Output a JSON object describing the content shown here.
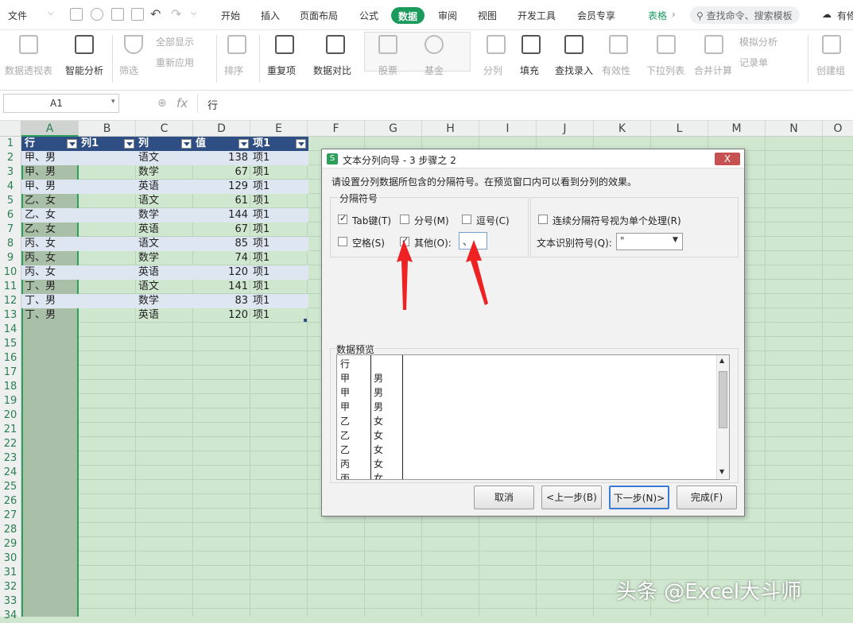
{
  "menu": {
    "file": "文件",
    "tabs": [
      "开始",
      "插入",
      "页面布局",
      "公式",
      "数据",
      "审阅",
      "视图",
      "开发工具",
      "会员专享",
      "表格"
    ],
    "active_tab": "数据",
    "search": "查找命令、搜索模板",
    "extra": "有修"
  },
  "ribbon": {
    "pivot": "数据透视表",
    "smart": "智能分析",
    "filter": "筛选",
    "show_all": "全部显示",
    "reapply": "重新应用",
    "sort": "排序",
    "duplicates": "重复项",
    "compare": "数据对比",
    "stocks": "股票",
    "fund": "基金",
    "split": "分列",
    "fill": "填充",
    "lookup": "查找录入",
    "validity": "有效性",
    "dropdown": "下拉列表",
    "consolidate": "合并计算",
    "simulate": "模拟分析",
    "record": "记录单",
    "group": "创建组"
  },
  "formula": {
    "name_box": "A1",
    "fx": "fx",
    "value": "行"
  },
  "columns": [
    "A",
    "B",
    "C",
    "D",
    "E",
    "F",
    "G",
    "H",
    "I",
    "J",
    "K",
    "L",
    "M",
    "N",
    "O"
  ],
  "rows": [
    "1",
    "2",
    "3",
    "4",
    "5",
    "6",
    "7",
    "8",
    "9",
    "10",
    "11",
    "12",
    "13",
    "14",
    "15",
    "16",
    "17",
    "18",
    "19",
    "20",
    "21",
    "22",
    "23",
    "24",
    "25",
    "26",
    "27",
    "28",
    "29",
    "30",
    "31",
    "32",
    "33",
    "34"
  ],
  "table": {
    "headers": [
      "行",
      "列1",
      "列",
      "值",
      "项1"
    ],
    "rows": [
      [
        "甲、男",
        "",
        "语文",
        "138",
        "项1"
      ],
      [
        "甲、男",
        "",
        "数学",
        "67",
        "项1"
      ],
      [
        "甲、男",
        "",
        "英语",
        "129",
        "项1"
      ],
      [
        "乙、女",
        "",
        "语文",
        "61",
        "项1"
      ],
      [
        "乙、女",
        "",
        "数学",
        "144",
        "项1"
      ],
      [
        "乙、女",
        "",
        "英语",
        "67",
        "项1"
      ],
      [
        "丙、女",
        "",
        "语文",
        "85",
        "项1"
      ],
      [
        "丙、女",
        "",
        "数学",
        "74",
        "项1"
      ],
      [
        "丙、女",
        "",
        "英语",
        "120",
        "项1"
      ],
      [
        "丁、男",
        "",
        "语文",
        "141",
        "项1"
      ],
      [
        "丁、男",
        "",
        "数学",
        "83",
        "项1"
      ],
      [
        "丁、男",
        "",
        "英语",
        "120",
        "项1"
      ]
    ]
  },
  "dialog": {
    "title": "文本分列向导 - 3 步骤之 2",
    "close": "X",
    "instruction": "请设置分列数据所包含的分隔符号。在预览窗口内可以看到分列的效果。",
    "group_label": "分隔符号",
    "tab": "Tab键(T)",
    "semicolon": "分号(M)",
    "comma": "逗号(C)",
    "space": "空格(S)",
    "other": "其他(O):",
    "other_value": "、",
    "consecutive": "连续分隔符号视为单个处理(R)",
    "qualifier_label": "文本识别符号(Q):",
    "qualifier_value": "\"",
    "preview_label": "数据预览",
    "preview_col1": [
      "行",
      "甲",
      "甲",
      "甲",
      "乙",
      "乙",
      "乙",
      "丙",
      "丙"
    ],
    "preview_col2": [
      "",
      "男",
      "男",
      "男",
      "女",
      "女",
      "女",
      "女",
      "女"
    ],
    "cancel": "取消",
    "back": "<上一步(B)",
    "next": "下一步(N)>",
    "finish": "完成(F)"
  },
  "watermark": "头条 @Excel大斗师"
}
